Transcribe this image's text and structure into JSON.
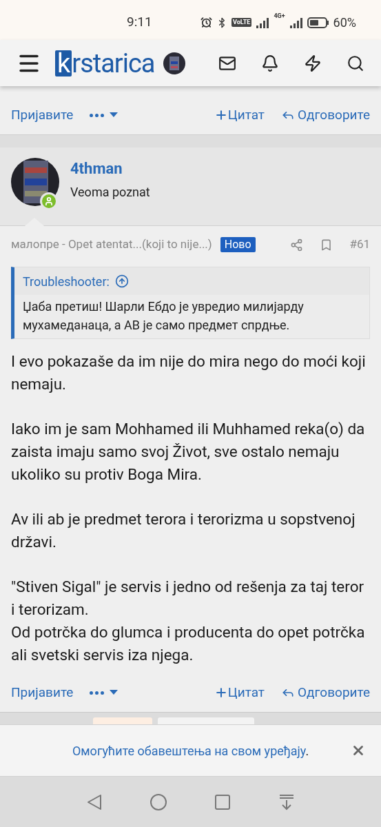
{
  "status_bar": {
    "time": "9:11",
    "volte": "VoLTE",
    "network": "4G+",
    "battery": "60%"
  },
  "header": {
    "logo_mark": "k",
    "logo_rest": "rstarica"
  },
  "prev_post_actions": {
    "report": "Пријавите",
    "quote": "Цитат",
    "reply": "Одговорите"
  },
  "post": {
    "username": "4thman",
    "user_title": "Veoma poznat",
    "online": true,
    "meta": "малопре - Opet atentat...(koji to nije...)",
    "badge": "Ново",
    "number": "#61",
    "quote": {
      "author": "Troubleshooter:",
      "text": "Џаба претиш! Шарли Ебдо је увредио милијарду мухамеданаца, а АВ је само предмет спрдње."
    },
    "paragraphs": [
      {
        "lines": [
          "I evo pokazaše da im nije do mira nego do moći koji nemaju."
        ]
      },
      {
        "lines": [
          "Iako im je sam Mohhamed ili Muhhamed reka(o) da zaista imaju samo svoj Život, sve ostalo nemaju ukoliko su protiv Boga Mira."
        ]
      },
      {
        "lines": [
          "Av ili ab je predmet terora i terorizma u sopstvenoj državi."
        ]
      },
      {
        "lines": [
          "\"Stiven Sigal\" je servis i jedno od rešenja za taj teror i terorizam.",
          "Od potrčka do glumca i producenta do opet potrčka ali svetski servis iza njega."
        ]
      }
    ],
    "actions": {
      "report": "Пријавите",
      "quote": "Цитат",
      "reply": "Одговорите"
    }
  },
  "notice": {
    "link": "Омогућите обавештења на свом уређају",
    "end": "."
  }
}
